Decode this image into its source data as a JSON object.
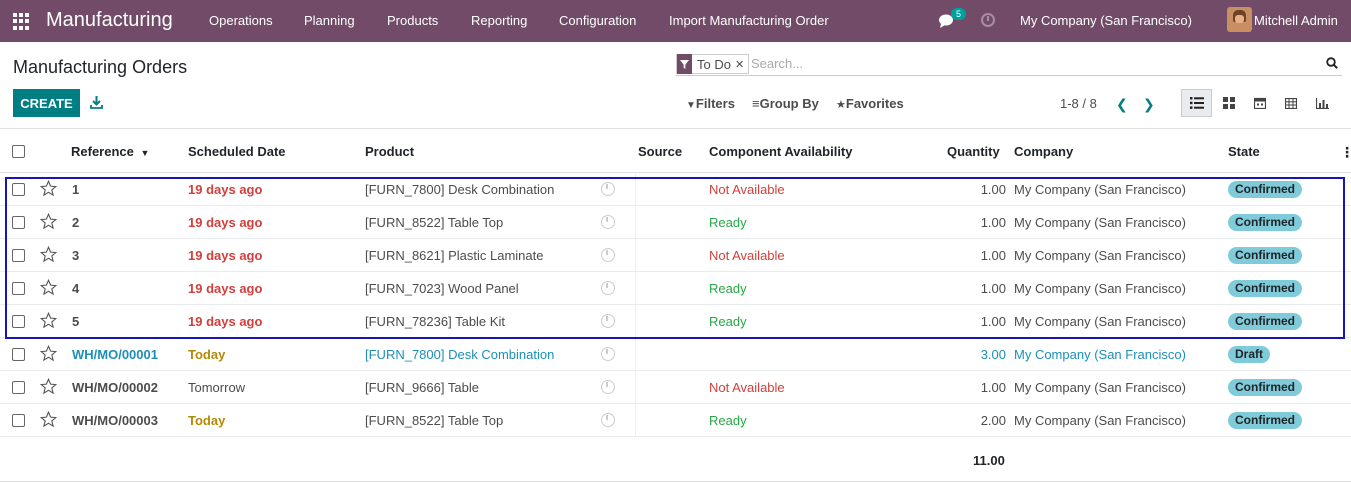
{
  "navbar": {
    "brand": "Manufacturing",
    "menu": [
      "Operations",
      "Planning",
      "Products",
      "Reporting",
      "Configuration",
      "Import Manufacturing Order"
    ],
    "chat_count": "5",
    "company": "My Company (San Francisco)",
    "user": "Mitchell Admin"
  },
  "control": {
    "title": "Manufacturing Orders",
    "facet": "To Do",
    "search_placeholder": "Search...",
    "create_label": "CREATE",
    "filters_label": "Filters",
    "groupby_label": "Group By",
    "favorites_label": "Favorites",
    "pager": "1-8 / 8"
  },
  "columns": {
    "reference": "Reference",
    "scheduled_date": "Scheduled Date",
    "product": "Product",
    "source": "Source",
    "component_availability": "Component Availability",
    "quantity": "Quantity",
    "company": "Company",
    "state": "State"
  },
  "rows": [
    {
      "ref": "1",
      "date": "19 days ago",
      "date_style": "late",
      "product": "[FURN_7800] Desk Combination",
      "avail": "Not Available",
      "avail_style": "bad",
      "qty": "1.00",
      "company": "My Company (San Francisco)",
      "state": "Confirmed",
      "draft": false
    },
    {
      "ref": "2",
      "date": "19 days ago",
      "date_style": "late",
      "product": "[FURN_8522] Table Top",
      "avail": "Ready",
      "avail_style": "good",
      "qty": "1.00",
      "company": "My Company (San Francisco)",
      "state": "Confirmed",
      "draft": false
    },
    {
      "ref": "3",
      "date": "19 days ago",
      "date_style": "late",
      "product": "[FURN_8621] Plastic Laminate",
      "avail": "Not Available",
      "avail_style": "bad",
      "qty": "1.00",
      "company": "My Company (San Francisco)",
      "state": "Confirmed",
      "draft": false
    },
    {
      "ref": "4",
      "date": "19 days ago",
      "date_style": "late",
      "product": "[FURN_7023] Wood Panel",
      "avail": "Ready",
      "avail_style": "good",
      "qty": "1.00",
      "company": "My Company (San Francisco)",
      "state": "Confirmed",
      "draft": false
    },
    {
      "ref": "5",
      "date": "19 days ago",
      "date_style": "late",
      "product": "[FURN_78236] Table Kit",
      "avail": "Ready",
      "avail_style": "good",
      "qty": "1.00",
      "company": "My Company (San Francisco)",
      "state": "Confirmed",
      "draft": false
    },
    {
      "ref": "WH/MO/00001",
      "date": "Today",
      "date_style": "today",
      "product": "[FURN_7800] Desk Combination",
      "avail": "",
      "avail_style": "none",
      "qty": "3.00",
      "company": "My Company (San Francisco)",
      "state": "Draft",
      "draft": true
    },
    {
      "ref": "WH/MO/00002",
      "date": "Tomorrow",
      "date_style": "normal",
      "product": "[FURN_9666] Table",
      "avail": "Not Available",
      "avail_style": "bad",
      "qty": "1.00",
      "company": "My Company (San Francisco)",
      "state": "Confirmed",
      "draft": false
    },
    {
      "ref": "WH/MO/00003",
      "date": "Today",
      "date_style": "today",
      "product": "[FURN_8522] Table Top",
      "avail": "Ready",
      "avail_style": "good",
      "qty": "2.00",
      "company": "My Company (San Francisco)",
      "state": "Confirmed",
      "draft": false
    }
  ],
  "total_quantity": "11.00",
  "colors": {
    "navbar": "#714b67",
    "primary": "#017e84",
    "late": "#d23f3a",
    "today": "#b18a07",
    "ready": "#28a745",
    "draft_link": "#1d8fb6",
    "state_badge": "#7fcbd9"
  }
}
